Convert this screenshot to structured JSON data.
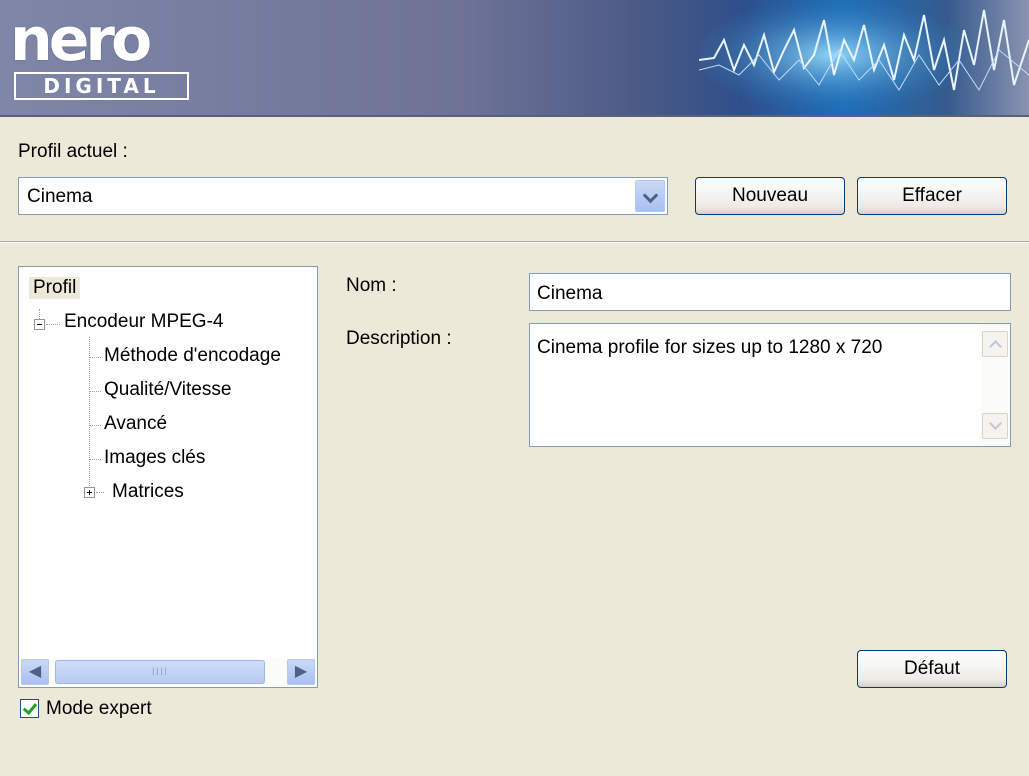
{
  "logo": {
    "top": "nero",
    "bottom": "DIGITAL"
  },
  "profile_current": {
    "label": "Profil actuel :",
    "value": "Cinema",
    "new_label": "Nouveau",
    "delete_label": "Effacer"
  },
  "tree": {
    "root": "Profil",
    "group": "Encodeur MPEG-4",
    "children": [
      "Méthode d'encodage",
      "Qualité/Vitesse",
      "Avancé",
      "Images clés"
    ],
    "collapsed_child": "Matrices",
    "scroll_grip": "IIII"
  },
  "expert_mode": {
    "label": "Mode expert",
    "checked": true
  },
  "form": {
    "name_label": "Nom :",
    "name_value": "Cinema",
    "description_label": "Description :",
    "description_value": "Cinema profile for sizes up to 1280 x 720",
    "default_label": "Défaut"
  }
}
